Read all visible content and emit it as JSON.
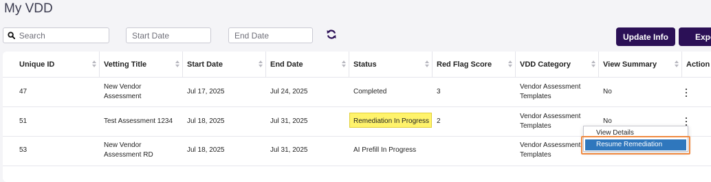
{
  "page": {
    "title": "My VDD"
  },
  "toolbar": {
    "search_placeholder": "Search",
    "start_date_placeholder": "Start Date",
    "end_date_placeholder": "End Date",
    "refresh_icon": "refresh-icon",
    "update_label": "Update Info",
    "export_label": "Expo"
  },
  "table": {
    "columns": [
      "Unique ID",
      "Vetting Title",
      "Start Date",
      "End Date",
      "Status",
      "Red Flag Score",
      "VDD Category",
      "View Summary",
      "Action"
    ],
    "rows": [
      {
        "id": "47",
        "title_line1": "New Vendor",
        "title_line2": "Assessment",
        "start": "Jul 17, 2025",
        "end": "Jul 24, 2025",
        "status": "Completed",
        "score": "3",
        "category_line1": "Vendor Assessment",
        "category_line2": "Templates",
        "summary": "No"
      },
      {
        "id": "51",
        "title_line1": "Test Assessment 1234",
        "start": "Jul 18, 2025",
        "end": "Jul 31, 2025",
        "status": "Remediation In Progress",
        "score": "2",
        "category_line1": "Vendor Assessment",
        "category_line2": "Templates",
        "summary": "No"
      },
      {
        "id": "53",
        "title_line1": "New Vendor",
        "title_line2": "Assessment RD",
        "start": "Jul 18, 2025",
        "end": "Jul 31, 2025",
        "status": "AI Prefill In Progress",
        "score": "",
        "category_line1": "Vendor Assessment",
        "category_line2": "Templates",
        "summary": ""
      }
    ]
  },
  "action_menu": {
    "view_details": "View Details",
    "resume_remediation": "Resume Remediation"
  },
  "colors": {
    "primary": "#2b1056",
    "highlight": "#fff36b",
    "menu_selected": "#2f77bd",
    "callout": "#f0883e"
  }
}
